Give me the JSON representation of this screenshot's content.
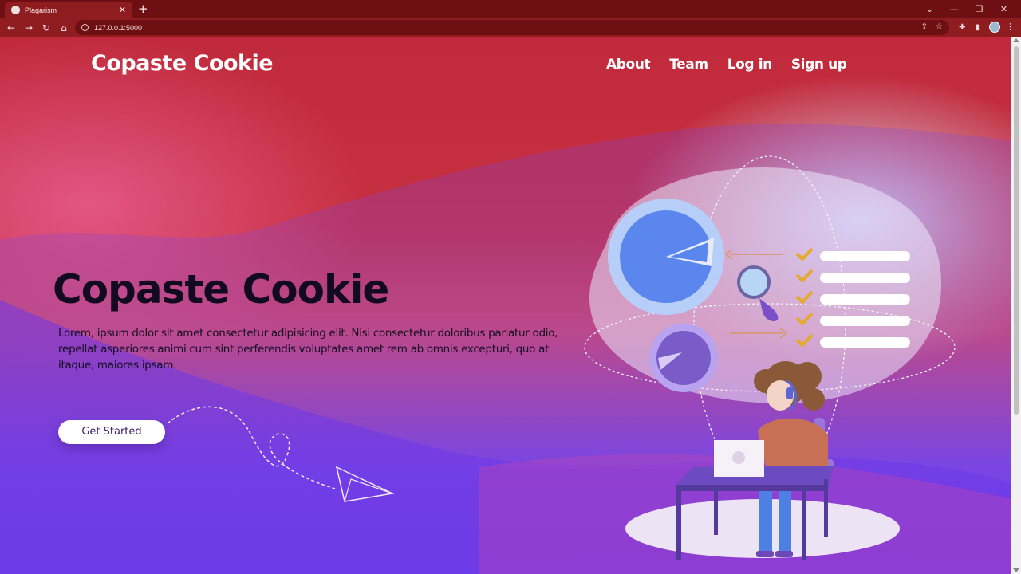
{
  "browser": {
    "tab_title": "Plagarism",
    "tab_close": "✕",
    "new_tab": "+",
    "url": "127.0.0.1:5000",
    "window_controls": [
      "⌄",
      "—",
      "❐",
      "✕"
    ]
  },
  "header": {
    "brand": "Copaste Cookie",
    "nav": [
      "About",
      "Team",
      "Log in",
      "Sign up"
    ]
  },
  "hero": {
    "title": "Copaste Cookie",
    "text": "Lorem, ipsum dolor sit amet consectetur adipisicing elit. Nisi consectetur doloribus pariatur odio, repellat asperiores animi cum sint perferendis voluptates amet rem ab omnis excepturi, quo at itaque, maiores ipsam.",
    "cta": "Get Started"
  },
  "colors": {
    "accent_red": "#c02a3c",
    "accent_purple": "#6a38e6",
    "chrome": "#8f1c1f"
  }
}
